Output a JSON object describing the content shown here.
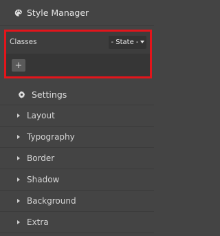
{
  "header": {
    "title": "Style Manager",
    "icon": "palette-icon"
  },
  "classes": {
    "label": "Classes",
    "state_label": "- State -",
    "add_label": "+"
  },
  "settings": {
    "label": "Settings",
    "icon": "gear-icon"
  },
  "sectors": [
    {
      "label": "Layout"
    },
    {
      "label": "Typography"
    },
    {
      "label": "Border"
    },
    {
      "label": "Shadow"
    },
    {
      "label": "Background"
    },
    {
      "label": "Extra"
    }
  ],
  "colors": {
    "panel_bg": "#444444",
    "highlight_border": "#e3151b",
    "text": "#dddddd"
  }
}
